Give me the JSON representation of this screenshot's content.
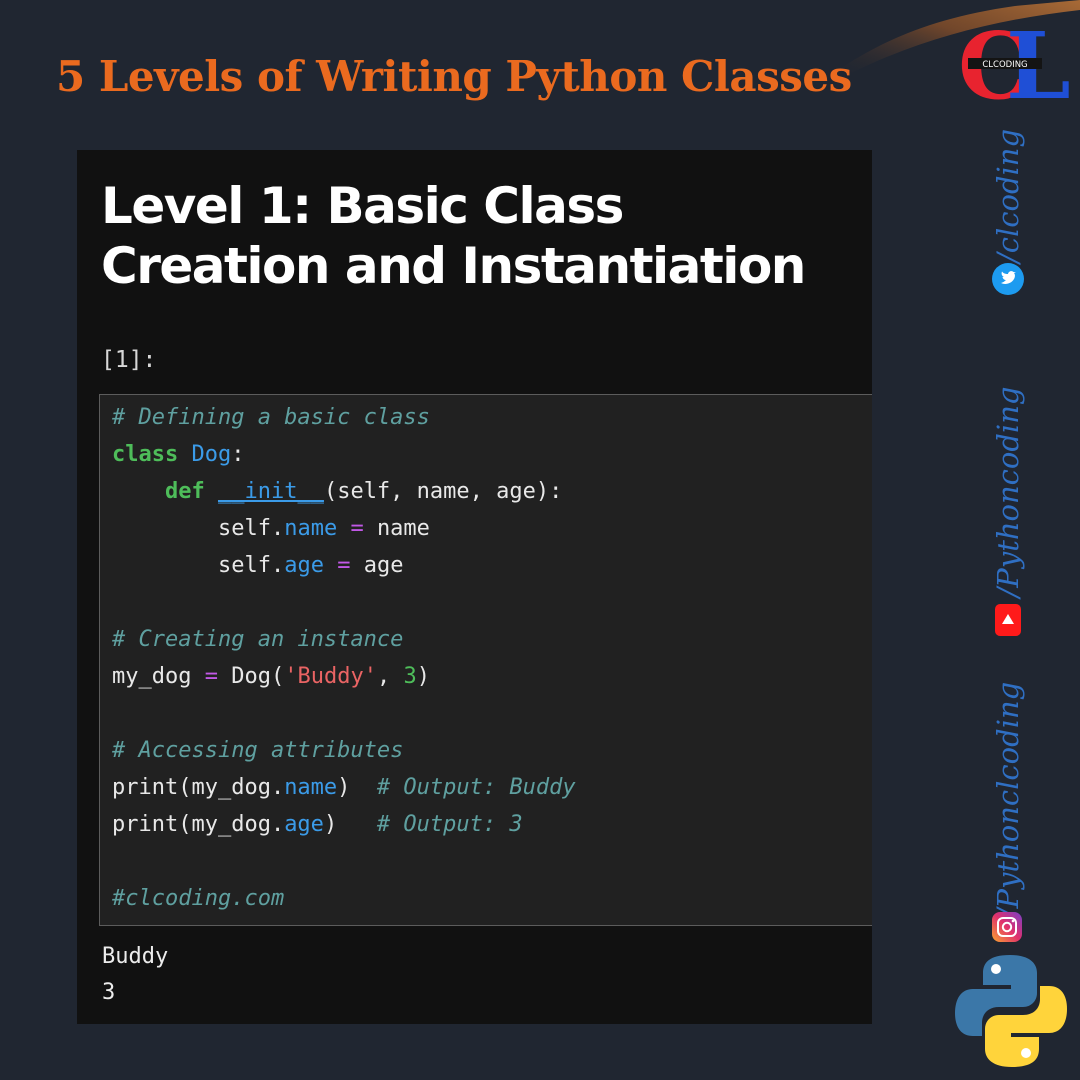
{
  "page": {
    "title": "5 Levels of Writing Python Classes",
    "logo_text": "CL",
    "logo_subtext": "CLCODING"
  },
  "notebook": {
    "heading": "Level 1: Basic Class Creation and Instantiation",
    "prompt": "[1]:",
    "code": {
      "comment1": "# Defining a basic class",
      "kw_class": "class",
      "class_name": "Dog",
      "colon1": ":",
      "indent1": "    ",
      "kw_def": "def",
      "fn_name": "__init__",
      "params": "(self, name, age):",
      "indent2": "        ",
      "self": "self.",
      "attr_name": "name",
      "eq": "=",
      "val_name": "name",
      "attr_age": "age",
      "val_age": "age",
      "comment2": "# Creating an instance",
      "var": "my_dog",
      "call_open": "Dog(",
      "str_buddy": "'Buddy'",
      "comma": ", ",
      "num_3": "3",
      "call_close": ")",
      "comment3": "# Accessing attributes",
      "print_open": "print(my_dog.",
      "print_close_name": ")  ",
      "out_comment1": "# Output: Buddy",
      "print_close_age": ")   ",
      "out_comment2": "# Output: 3",
      "comment4": "#clcoding.com"
    },
    "output": [
      "Buddy",
      "3"
    ]
  },
  "social": {
    "twitter_handle": "/clcoding",
    "youtube_handle": "/Pythoncoding",
    "instagram_handle": "/Pythonclcoding"
  },
  "colors": {
    "background": "#202631",
    "title": "#ea6a1f",
    "social_text": "#2f6fc3",
    "keyword": "#4ebd5a",
    "name": "#3b9be8",
    "operator": "#c158e6",
    "string": "#ea6464",
    "comment": "#5fa0a0"
  }
}
